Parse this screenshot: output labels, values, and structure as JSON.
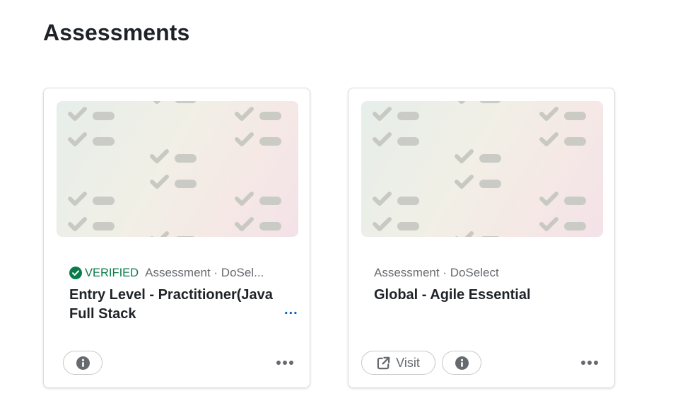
{
  "page": {
    "title": "Assessments"
  },
  "cards": [
    {
      "verified": true,
      "verified_label": "VERIFIED",
      "meta": "Assessment · DoSel...",
      "title": "Entry Level - Practitioner(Java Full Stack",
      "see_more": "...",
      "buttons": [
        "info"
      ],
      "more_icon": "ellipsis-horizontal-icon"
    },
    {
      "verified": false,
      "meta": "Assessment · DoSelect",
      "title": "Global - Agile Essential",
      "visit_label": "Visit",
      "buttons": [
        "visit",
        "info"
      ],
      "more_icon": "ellipsis-horizontal-icon"
    }
  ],
  "icons": {
    "verified": "check-circle-icon",
    "info": "info-circle-icon",
    "visit": "external-link-icon",
    "banner_pattern": "checklist-icon"
  },
  "colors": {
    "verified_green": "#0a7c4a",
    "link_blue": "#0a66c2",
    "muted_text": "#666a6f"
  }
}
